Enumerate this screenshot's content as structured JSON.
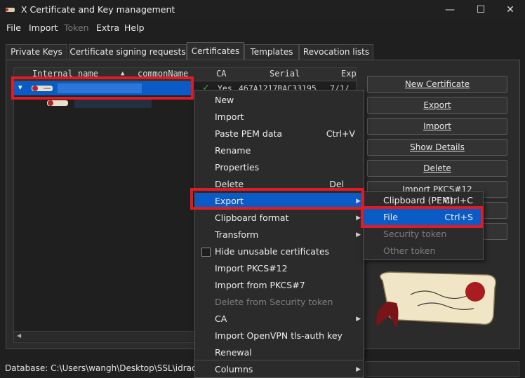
{
  "window": {
    "title": "X Certificate and Key management",
    "controls": {
      "minimize": "—",
      "maximize": "☐",
      "close": "✕"
    }
  },
  "menubar": [
    {
      "label": "File",
      "enabled": true
    },
    {
      "label": "Import",
      "enabled": true
    },
    {
      "label": "Token",
      "enabled": false
    },
    {
      "label": "Extra",
      "enabled": true
    },
    {
      "label": "Help",
      "enabled": true
    }
  ],
  "tabs": [
    {
      "label": "Private Keys"
    },
    {
      "label": "Certificate signing requests"
    },
    {
      "label": "Certificates",
      "active": true
    },
    {
      "label": "Templates"
    },
    {
      "label": "Revocation lists"
    }
  ],
  "tree": {
    "columns": [
      "Internal name",
      "commonName",
      "CA",
      "Serial",
      "Exp"
    ],
    "sort_indicator": "▲",
    "row1": {
      "ca": "Yes",
      "serial": "467A1217BAC33195",
      "expiry": "7/1/"
    },
    "check_mark": "✓",
    "expand_arrow": "▾"
  },
  "side_buttons": [
    "New Certificate",
    "Export",
    "Import",
    "Show Details",
    "Delete",
    "Import PKCS#12",
    "",
    ""
  ],
  "context_menu": [
    {
      "label": "New"
    },
    {
      "label": "Import"
    },
    {
      "label": "Paste PEM data",
      "shortcut": "Ctrl+V"
    },
    {
      "label": "Rename"
    },
    {
      "label": "Properties"
    },
    {
      "label": "Delete",
      "shortcut": "Del"
    },
    {
      "label": "Export",
      "submenu": true,
      "highlighted": true
    },
    {
      "label": "Clipboard format",
      "submenu": true
    },
    {
      "label": "Transform",
      "submenu": true
    },
    {
      "label": "Hide unusable certificates",
      "checkbox": true
    },
    {
      "label": "Import PKCS#12"
    },
    {
      "label": "Import from PKCS#7"
    },
    {
      "label": "Delete from Security token",
      "disabled": true
    },
    {
      "label": "CA",
      "submenu": true
    },
    {
      "label": "Import OpenVPN tls-auth key"
    },
    {
      "label": "Renewal"
    },
    {
      "label": "Columns",
      "submenu": true
    }
  ],
  "export_submenu": [
    {
      "label": "Clipboard (PEM)",
      "shortcut": "Ctrl+C"
    },
    {
      "label": "File",
      "shortcut": "Ctrl+S",
      "highlighted": true
    },
    {
      "label": "Security token",
      "disabled": true
    },
    {
      "label": "Other token",
      "disabled": true
    }
  ],
  "status": {
    "database": "Database: C:\\Users\\wangh\\Desktop\\SSL\\idrac.xdb"
  },
  "colors": {
    "accent": "#0a5bc6",
    "annotation": "#e01b24",
    "check": "#3cb34a"
  }
}
